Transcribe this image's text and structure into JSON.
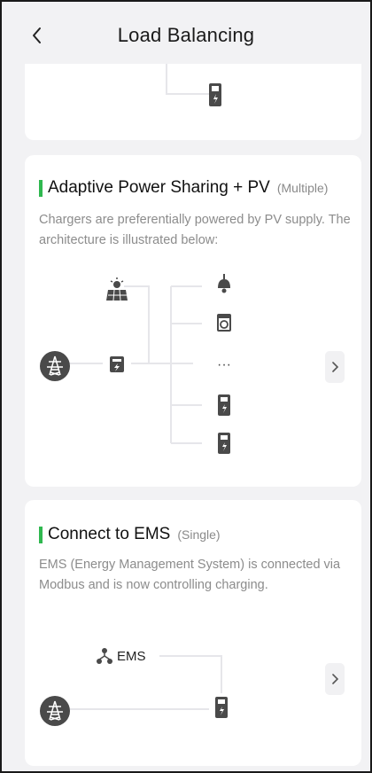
{
  "header": {
    "title": "Load Balancing"
  },
  "cards": {
    "adaptive": {
      "title": "Adaptive Power Sharing + PV",
      "qualifier": "(Multiple)",
      "description": "Chargers are preferentially powered by PV supply. The architecture is illustrated below:",
      "more_text": "···"
    },
    "ems": {
      "title": "Connect to EMS",
      "qualifier": "(Single)",
      "description": "EMS (Energy Management System) is connected via Modbus and is now controlling charging.",
      "ems_label": "EMS"
    }
  },
  "colors": {
    "accent": "#2fb84f",
    "icon": "#4a4a4a",
    "background": "#f2f2f4",
    "card": "#ffffff"
  },
  "icons": [
    "back-arrow-icon",
    "charger-icon",
    "solar-panel-icon",
    "power-tower-icon",
    "inverter-icon",
    "lamp-icon",
    "washing-machine-icon",
    "network-icon",
    "chevron-right-icon"
  ]
}
